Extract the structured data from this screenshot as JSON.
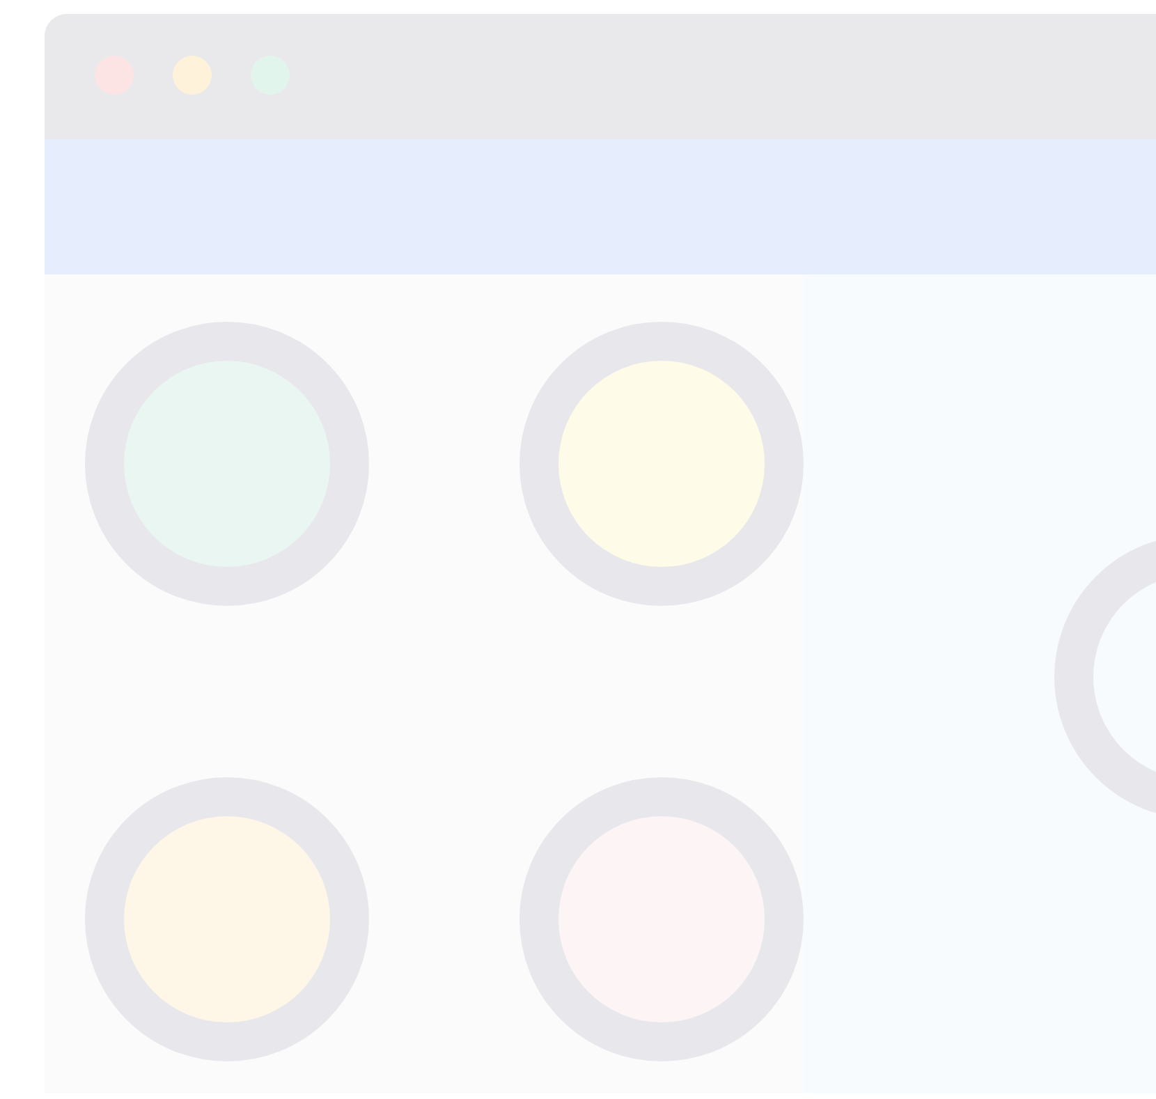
{
  "window": {
    "controls": [
      {
        "color": "#fde4e4"
      },
      {
        "color": "#fef2da"
      },
      {
        "color": "#e2f5ec"
      }
    ]
  },
  "left_panel": {
    "circles": [
      {
        "color": "#e9f6f1"
      },
      {
        "color": "#fefbe9"
      },
      {
        "color": "#fef7e8"
      },
      {
        "color": "#fdf5f5"
      }
    ]
  }
}
